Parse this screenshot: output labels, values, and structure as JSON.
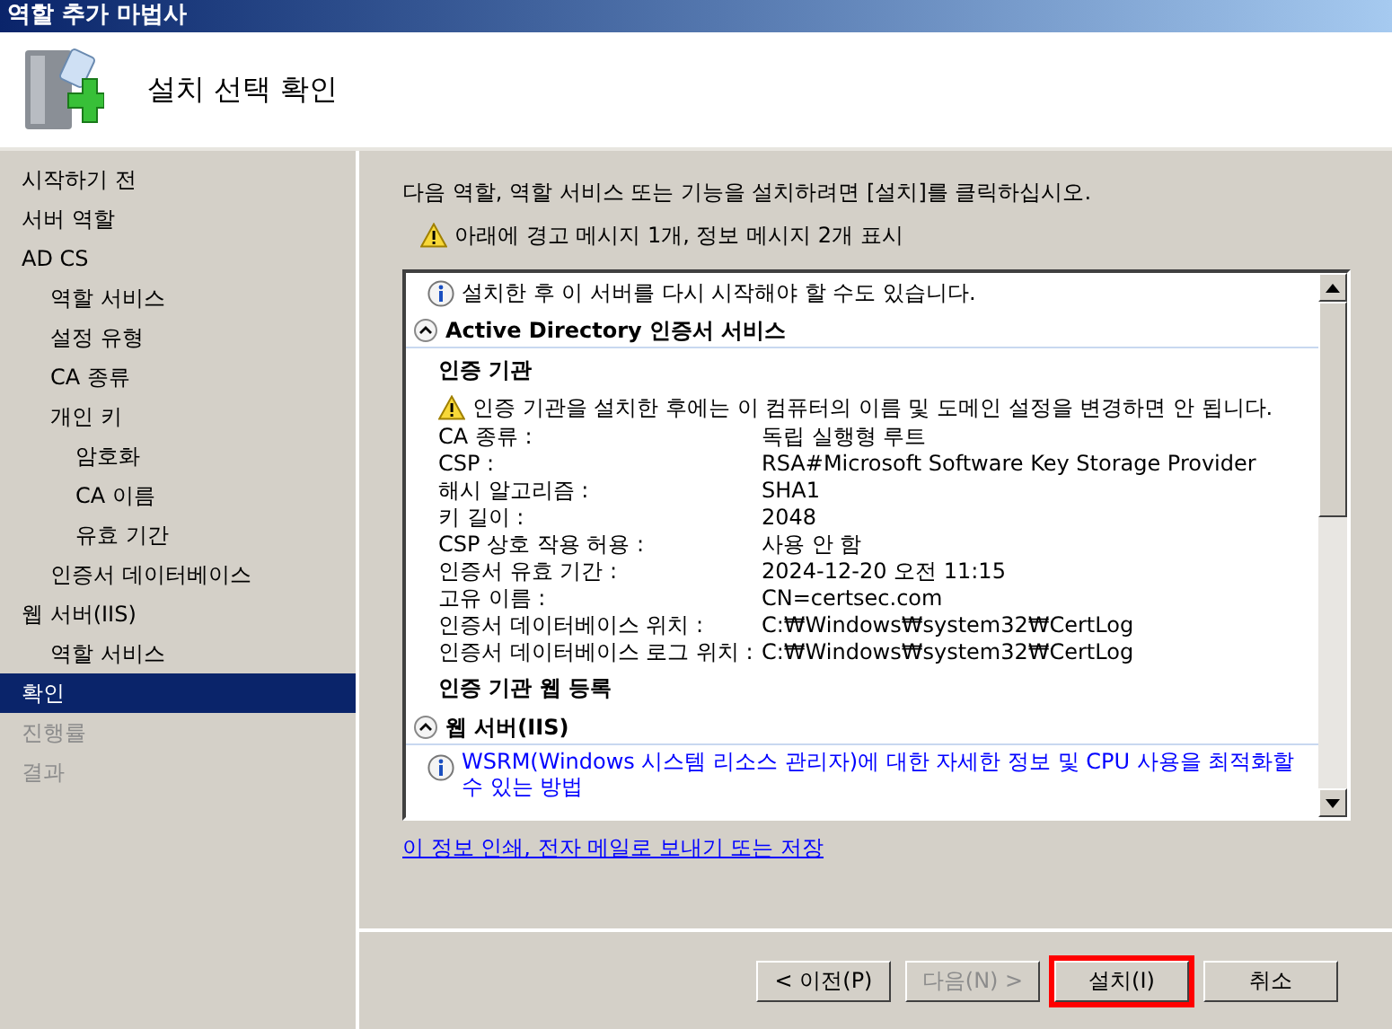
{
  "window": {
    "title": "역할 추가 마법사"
  },
  "header": {
    "title": "설치 선택 확인"
  },
  "sidebar": {
    "items": [
      {
        "label": "시작하기 전",
        "selected": false,
        "disabled": false
      },
      {
        "label": "서버 역할",
        "selected": false,
        "disabled": false
      },
      {
        "label": "AD CS",
        "selected": false,
        "disabled": false,
        "children": [
          {
            "label": "역할 서비스",
            "selected": false,
            "disabled": false
          },
          {
            "label": "설정 유형",
            "selected": false,
            "disabled": false
          },
          {
            "label": "CA 종류",
            "selected": false,
            "disabled": false
          },
          {
            "label": "개인 키",
            "selected": false,
            "disabled": false,
            "children": [
              {
                "label": "암호화",
                "selected": false,
                "disabled": false
              },
              {
                "label": "CA 이름",
                "selected": false,
                "disabled": false
              },
              {
                "label": "유효 기간",
                "selected": false,
                "disabled": false
              }
            ]
          },
          {
            "label": "인증서 데이터베이스",
            "selected": false,
            "disabled": false
          }
        ]
      },
      {
        "label": "웹 서버(IIS)",
        "selected": false,
        "disabled": false,
        "children": [
          {
            "label": "역할 서비스",
            "selected": false,
            "disabled": false
          }
        ]
      },
      {
        "label": "확인",
        "selected": true,
        "disabled": false
      },
      {
        "label": "진행률",
        "selected": false,
        "disabled": true
      },
      {
        "label": "결과",
        "selected": false,
        "disabled": true
      }
    ]
  },
  "content": {
    "instruction": "다음 역할, 역할 서비스 또는 기능을 설치하려면 [설치]를 클릭하십시오.",
    "summary": "아래에 경고 메시지 1개, 정보 메시지 2개 표시",
    "details": [
      {
        "kind": "info",
        "text": "설치한 후 이 서버를 다시 시작해야 할 수도 있습니다."
      },
      {
        "kind": "section",
        "text": "Active Directory 인증서 서비스"
      },
      {
        "kind": "subheading",
        "text": "인증 기관"
      },
      {
        "kind": "warning",
        "text": "인증 기관을 설치한 후에는 이 컴퓨터의 이름 및 도메인 설정을 변경하면 안 됩니다."
      },
      {
        "kind": "property",
        "label": "CA 종류 :",
        "value": "독립 실행형 루트"
      },
      {
        "kind": "property",
        "label": "CSP :",
        "value": "RSA#Microsoft Software Key Storage Provider"
      },
      {
        "kind": "property",
        "label": "해시 알고리즘 :",
        "value": "SHA1"
      },
      {
        "kind": "property",
        "label": "키 길이 :",
        "value": "2048"
      },
      {
        "kind": "property",
        "label": "CSP 상호 작용 허용 :",
        "value": "사용 안 함"
      },
      {
        "kind": "property",
        "label": "인증서 유효 기간 :",
        "value": "2024-12-20 오전 11:15"
      },
      {
        "kind": "property",
        "label": "고유 이름 :",
        "value": "CN=certsec.com"
      },
      {
        "kind": "property",
        "label": "인증서 데이터베이스 위치 :",
        "value": "C:₩Windows₩system32₩CertLog"
      },
      {
        "kind": "property",
        "label": "인증서 데이터베이스 로그 위치 :",
        "value": "C:₩Windows₩system32₩CertLog"
      },
      {
        "kind": "subheading",
        "text": "인증 기관 웹 등록"
      },
      {
        "kind": "section",
        "text": "웹 서버(IIS)"
      },
      {
        "kind": "infolink",
        "text": "WSRM(Windows 시스템 리소스 관리자)에 대한 자세한 정보 및 CPU 사용을 최적화할 수 있는 방법"
      }
    ],
    "footer_link": "이 정보 인쇄, 전자 메일로 보내기 또는 저장"
  },
  "buttons": [
    {
      "label": "< 이전(P)",
      "disabled": false,
      "highlighted": false
    },
    {
      "label": "다음(N) >",
      "disabled": true,
      "highlighted": false
    },
    {
      "label": "설치(I)",
      "disabled": false,
      "highlighted": true
    },
    {
      "label": "취소",
      "disabled": false,
      "highlighted": false
    }
  ]
}
